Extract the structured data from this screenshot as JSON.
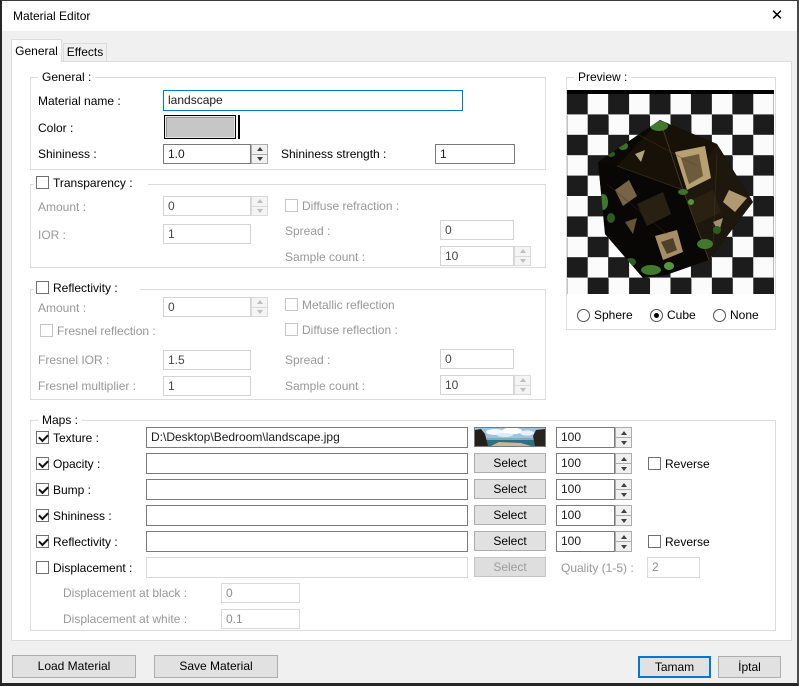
{
  "window": {
    "title": "Material Editor"
  },
  "colors": {
    "accent": "#0078d7",
    "checker_dark": "#1c1c1c",
    "checker_light": "#fbfbfb",
    "color_swatch": "#c6c6c6"
  },
  "tabs": [
    {
      "label": "General"
    },
    {
      "label": "Effects"
    }
  ],
  "general": {
    "title": "General :",
    "material_name_label": "Material name :",
    "material_name_value": "landscape",
    "color_label": "Color :",
    "shininess_label": "Shininess :",
    "shininess_value": "1.0",
    "shininess_strength_label": "Shininess strength :",
    "shininess_strength_value": "1"
  },
  "transparency": {
    "title": "Transparency :",
    "checked": false,
    "amount_label": "Amount :",
    "amount_value": "0",
    "ior_label": "IOR :",
    "ior_value": "1",
    "diffuse_refraction_label": "Diffuse refraction :",
    "spread_label": "Spread :",
    "spread_value": "0",
    "sample_count_label": "Sample count :",
    "sample_count_value": "10"
  },
  "reflectivity": {
    "title": "Reflectivity :",
    "checked": false,
    "amount_label": "Amount :",
    "amount_value": "0",
    "metallic_label": "Metallic reflection",
    "fresnel_reflection_label": "Fresnel reflection :",
    "diffuse_reflection_label": "Diffuse reflection :",
    "fresnel_ior_label": "Fresnel IOR :",
    "fresnel_ior_value": "1.5",
    "spread_label": "Spread :",
    "spread_value": "0",
    "fresnel_multiplier_label": "Fresnel multiplier :",
    "fresnel_multiplier_value": "1",
    "sample_count_label": "Sample count :",
    "sample_count_value": "10"
  },
  "maps": {
    "title": "Maps :",
    "select_label": "Select",
    "reverse_label": "Reverse",
    "rows": [
      {
        "label": "Texture :",
        "checked": true,
        "path": "D:\\Desktop\\Bedroom\\landscape.jpg",
        "amount": "100"
      },
      {
        "label": "Opacity :",
        "checked": true,
        "path": "",
        "amount": "100",
        "reverse": false
      },
      {
        "label": "Bump :",
        "checked": true,
        "path": "",
        "amount": "100"
      },
      {
        "label": "Shininess :",
        "checked": true,
        "path": "",
        "amount": "100"
      },
      {
        "label": "Reflectivity :",
        "checked": true,
        "path": "",
        "amount": "100",
        "reverse": false
      },
      {
        "label": "Displacement :",
        "checked": false,
        "path": ""
      }
    ],
    "quality_label": "Quality (1-5) :",
    "quality_value": "2",
    "displacement_black_label": "Displacement at black :",
    "displacement_black_value": "0",
    "displacement_white_label": "Displacement at white :",
    "displacement_white_value": "0.1"
  },
  "preview": {
    "title": "Preview :",
    "radios": [
      {
        "label": "Sphere",
        "selected": false
      },
      {
        "label": "Cube",
        "selected": true
      },
      {
        "label": "None",
        "selected": false
      }
    ]
  },
  "footer": {
    "load_label": "Load Material",
    "save_label": "Save Material",
    "ok_label": "Tamam",
    "cancel_label": "İptal"
  }
}
